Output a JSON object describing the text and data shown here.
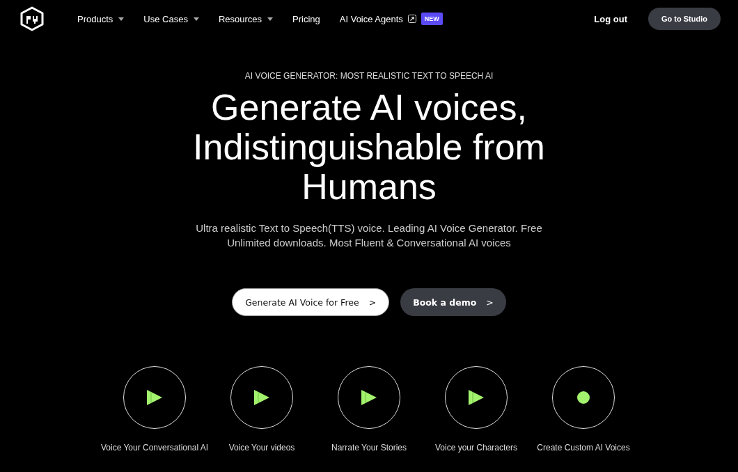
{
  "nav": {
    "items": [
      {
        "label": "Products",
        "dropdown": true,
        "external": false
      },
      {
        "label": "Use Cases",
        "dropdown": true,
        "external": false
      },
      {
        "label": "Resources",
        "dropdown": true,
        "external": false
      },
      {
        "label": "Pricing",
        "dropdown": false,
        "external": false
      },
      {
        "label": "AI Voice Agents",
        "dropdown": false,
        "external": true,
        "badge": "NEW"
      }
    ],
    "logout": "Log out",
    "studio": "Go to Studio"
  },
  "hero": {
    "eyebrow": "AI VOICE GENERATOR: MOST REALISTIC TEXT TO SPEECH AI",
    "title_lines": [
      "Generate AI voices,",
      "Indistinguishable from",
      "Humans"
    ],
    "subtitle_lines": [
      "Ultra realistic Text to Speech(TTS) voice. Leading AI Voice Generator. Free",
      "Unlimited downloads. Most Fluent & Conversational AI voices"
    ],
    "primary_button": "Generate AI Voice for Free",
    "primary_chevron": ">",
    "secondary_button": "Book a demo",
    "secondary_chevron": ">"
  },
  "samples": [
    {
      "kind": "play",
      "label": "Voice Your Conversational AI"
    },
    {
      "kind": "play",
      "label": "Voice Your videos"
    },
    {
      "kind": "play",
      "label": "Narrate Your Stories"
    },
    {
      "kind": "play",
      "label": "Voice your Characters"
    },
    {
      "kind": "record",
      "label": "Create Custom AI Voices"
    }
  ]
}
